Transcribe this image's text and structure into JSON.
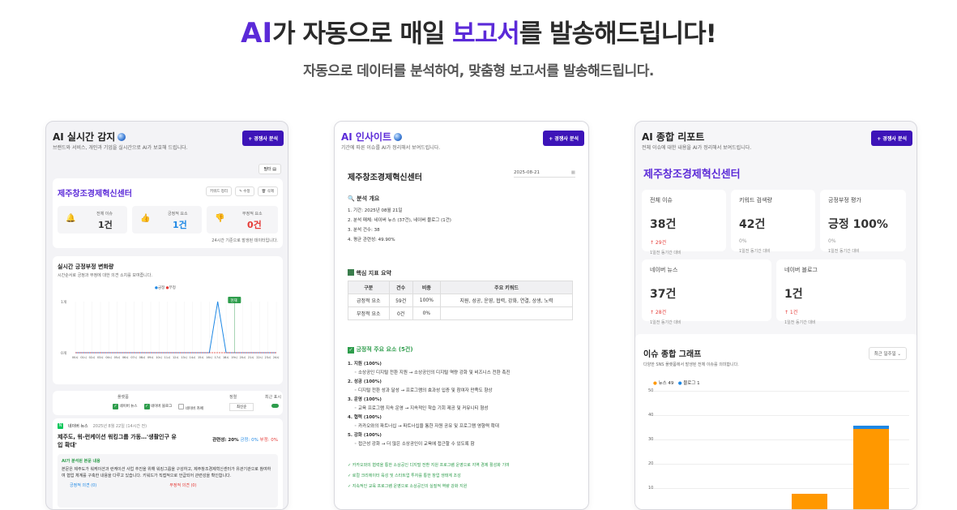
{
  "hero": {
    "ai": "AI",
    "part1": "가 자동으로 매일 ",
    "highlight": "보고서",
    "part2": "를 발송해드립니다!",
    "subtitle": "자동으로 데이터를 분석하여, 맞춤형 보고서를 발송해드립니다."
  },
  "card1": {
    "title": "AI 실시간 감지",
    "desc": "브랜드와 서비스, 개인과 기업을 실시간으로 AI가 보호해 드립니다.",
    "button": "+ 경쟁사 분석",
    "filter": "필터",
    "company": "제주창조경제혁신센터",
    "actions": [
      "키워드 정리",
      "✎ 수정",
      "🗑 삭제"
    ],
    "stats": [
      {
        "label": "전체 이슈",
        "value": "1건"
      },
      {
        "label": "긍정적 요소",
        "value": "1건"
      },
      {
        "label": "부정적 요소",
        "value": "0건"
      }
    ],
    "updated": "24시간 기준으로 발생된 데이터입니다.",
    "chart_title": "실시간 긍정부정 변화량",
    "chart_desc": "시간순서로 긍정과 부정에 대한 의견 소치를 보여줍니다.",
    "legend": [
      "긍정",
      "부정"
    ],
    "tooltip": "현재",
    "filters": {
      "platform_label": "플랫폼",
      "period_label": "정렬",
      "sort_label": "최근 표시",
      "options": [
        "네이버 뉴스",
        "네이버 블로그",
        "네이버 카페"
      ],
      "sort_value": "최신순"
    },
    "news": {
      "source": "네이버 뉴스",
      "date": "2025년 8월 22일 (14시간 전)",
      "headline": "제주도, 워-런케이션 워킹그룹 가동…'생활인구 유입 확대'",
      "relevance": "관련성: 20%",
      "positive": "긍정: 0%",
      "negative": "부정: 0%",
      "ai_label": "AI가 분석된 본문 내용",
      "ai_text": "본문은 제주도가 워케이션과 런케이션 사업 추진을 위해 워킹그룹을 구성하고, 제주창조경제혁신센터가 유관기관으로 참여하여 협업 체계를 구축한 내용을 다루고 있습니다. 키워드가 직접적으로 언급되어 관련성을 확인합니다.",
      "pos_opinion": "긍정적 의견 (0)",
      "neg_opinion": "부정적 의견 (0)"
    }
  },
  "chart_data": {
    "type": "line",
    "series": [
      {
        "name": "긍정",
        "values": [
          0,
          0,
          0,
          0,
          0,
          0,
          0,
          0,
          0,
          0,
          0,
          0,
          0,
          0,
          0,
          0,
          0,
          1,
          0,
          0,
          0,
          0,
          0,
          0,
          0
        ]
      },
      {
        "name": "부정",
        "values": [
          0,
          0,
          0,
          0,
          0,
          0,
          0,
          0,
          0,
          0,
          0,
          0,
          0,
          0,
          0,
          0,
          0,
          0,
          0,
          0,
          0,
          0,
          0,
          0,
          0
        ]
      }
    ],
    "x": [
      "00시",
      "01시",
      "02시",
      "03시",
      "04시",
      "05시",
      "06시",
      "07시",
      "08시",
      "09시",
      "10시",
      "11시",
      "12시",
      "13시",
      "14시",
      "15시",
      "16시",
      "17시",
      "18시",
      "19시",
      "20시",
      "21시",
      "22시",
      "23시",
      "24시"
    ],
    "y_ticks": [
      "1개",
      "0개"
    ],
    "ylim": [
      0,
      1
    ]
  },
  "card2": {
    "title": "AI 인사이트",
    "desc": "기간에 따른 이슈를 AI가 정리해서 보여드립니다.",
    "button": "+ 경쟁사 분석",
    "company": "제주창조경제혁신센터",
    "date": "2025-08-21",
    "overview_title": "🔍 분석 개요",
    "overview": [
      "1. 기간: 2025년 08월 21일",
      "2. 분석 매체: 네이버 뉴스 (37건), 네이버 블로그 (1건)",
      "3. 분석 건수: 38",
      "4. 평균 관련성: 49.90%"
    ],
    "kpi_title": "핵심 지표 요약",
    "kpi_headers": [
      "구분",
      "건수",
      "비중",
      "주요 키워드"
    ],
    "kpi_rows": [
      [
        "긍정적 요소",
        "59건",
        "100%",
        "지원, 성공, 운영, 협력, 강화, 연결, 상생, 노력"
      ],
      [
        "부정적 요소",
        "0건",
        "0%",
        ""
      ]
    ],
    "pos_title": "긍정적 주요 요소 (5건)",
    "pos_items": [
      {
        "h": "1. 지원 (100%)",
        "d": "소상공인 디지털 전환 지원 → 소상공인의 디지털 역량 강화 및 비즈니스 전환 촉진"
      },
      {
        "h": "2. 성공 (100%)",
        "d": "디지털 전환 성과 달성 → 프로그램의 효과성 입증 및 참여자 만족도 향상"
      },
      {
        "h": "3. 운영 (100%)",
        "d": "교육 프로그램 지속 운영 → 지속적인 학습 기회 제공 및 커뮤니티 형성"
      },
      {
        "h": "4. 협력 (100%)",
        "d": "카카오와의 파트너십 → 파트너십을 통한 자원 공유 및 프로그램 영향력 확대"
      },
      {
        "h": "5. 강화 (100%)",
        "d": "접근성 강화 → 더 많은 소상공인이 교육에 접근할 수 있도록 함"
      }
    ],
    "checks": [
      "✓ 카카오와의 협력을 통한 소상공인 디지털 전환 지원 프로그램 운영으로 지역 경제 활성화 기여",
      "✓ 로컬 크리에이터 육성 및 스타트업 투자를 통한 창업 생태계 조성",
      "✓ 지속적인 교육 프로그램 운영으로 소상공인의 실질적 역량 강화 지원"
    ]
  },
  "card3": {
    "title": "AI 종합 리포트",
    "desc": "전체 이슈에 대한 내용을 AI가 정리해서 보여드립니다.",
    "button": "+ 경쟁사 분석",
    "company": "제주창조경제혁신센터",
    "stats": [
      {
        "label": "전체 이슈",
        "value": "38건",
        "change": "↑ 29건",
        "compare": "1일전 동기간 대비"
      },
      {
        "label": "키워드 검색량",
        "value": "42건",
        "change": "0%",
        "compare": "1일전 동기간 대비"
      },
      {
        "label": "긍정부정 평가",
        "value": "긍정 100%",
        "change": "0%",
        "compare": "1일전 동기간 대비"
      },
      {
        "label": "네이버 뉴스",
        "value": "37건",
        "change": "↑ 28건",
        "compare": "1일전 동기간 대비"
      },
      {
        "label": "네이버 블로그",
        "value": "1건",
        "change": "↑ 1건",
        "compare": "1일전 동기간 대비"
      }
    ],
    "graph_title": "이슈 종합 그래프",
    "graph_desc": "다양한 SNS 플랫폼에서 발생된 전체 이슈를 의미합니다.",
    "select": "최근 일주일",
    "legend": [
      "뉴스 49",
      "블로그 1"
    ],
    "y_ticks": [
      "50",
      "40",
      "30",
      "20",
      "10"
    ]
  },
  "colors": {
    "accent": "#5b2ad8",
    "button": "#3d14b8",
    "positive": "#1e88e5",
    "negative": "#e53935",
    "bar_news": "#ff9800",
    "bar_blog": "#1e88e5"
  }
}
